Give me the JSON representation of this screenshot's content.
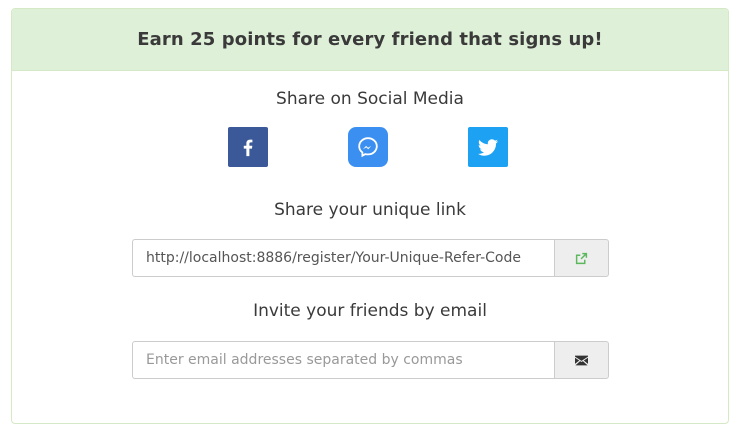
{
  "header": {
    "title": "Earn 25 points for every friend that signs up!"
  },
  "social": {
    "title": "Share on Social Media",
    "buttons": [
      {
        "name": "Facebook",
        "icon": "facebook-icon",
        "color": "#3b5998"
      },
      {
        "name": "Messenger",
        "icon": "messenger-icon",
        "color": "#3b8ff0"
      },
      {
        "name": "Twitter",
        "icon": "twitter-icon",
        "color": "#1da1f2"
      }
    ]
  },
  "link": {
    "title": "Share your unique link",
    "value": "http://localhost:8886/register/Your-Unique-Refer-Code",
    "action_icon": "external-link-icon"
  },
  "email": {
    "title": "Invite your friends by email",
    "placeholder": "Enter email addresses separated by commas",
    "value": "",
    "action_icon": "envelope-icon"
  },
  "colors": {
    "heading_bg": "#dff0d8",
    "border": "#d6e9c6",
    "link_icon": "#5cb85c"
  }
}
